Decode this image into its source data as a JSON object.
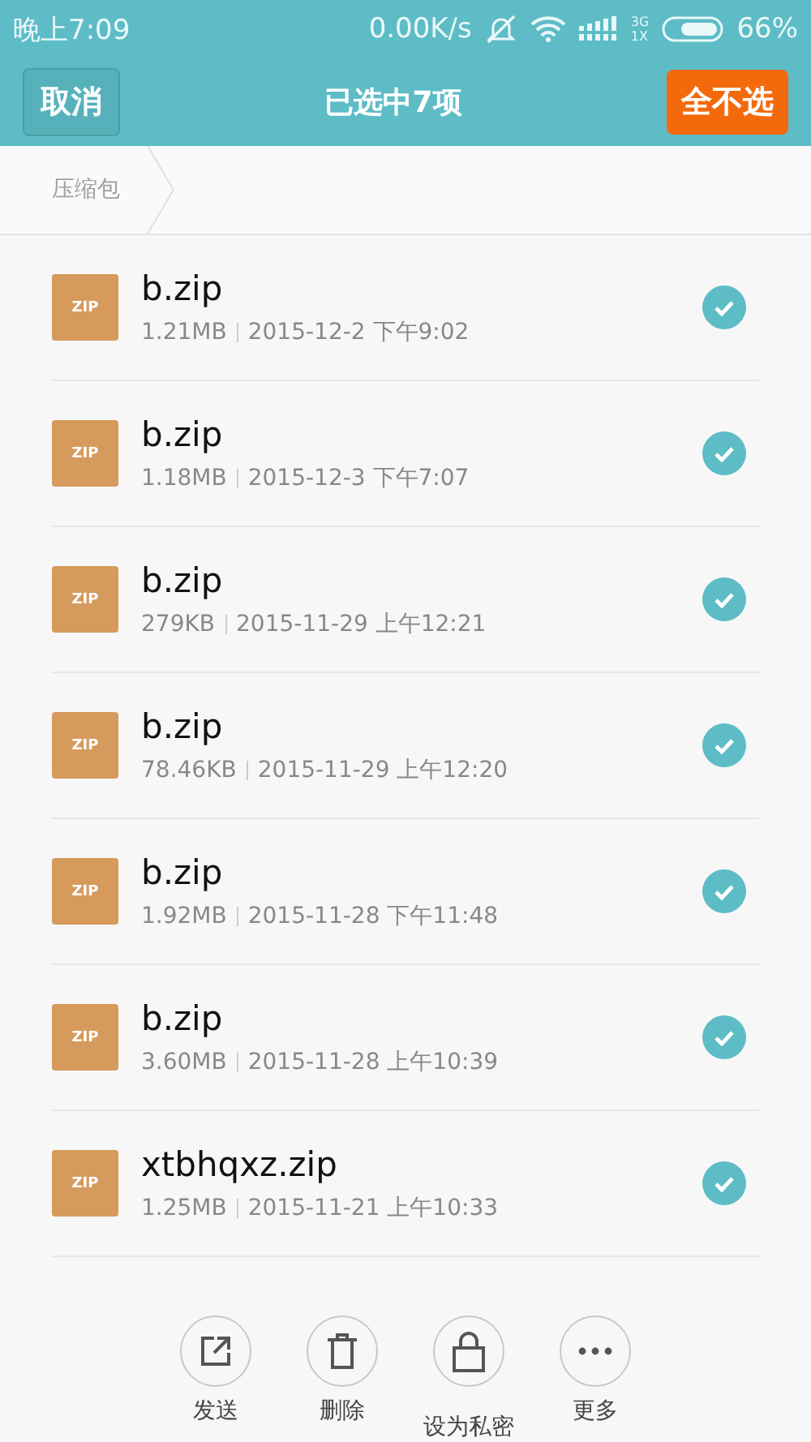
{
  "status_bar": {
    "time": "晚上7:09",
    "speed": "0.00K/s",
    "network_top": "3G",
    "network_bottom": "1X",
    "battery": "66%"
  },
  "header": {
    "cancel": "取消",
    "title": "已选中7项",
    "deselect_all": "全不选"
  },
  "breadcrumb": {
    "items": [
      "压缩包"
    ]
  },
  "files": [
    {
      "name": "b.zip",
      "type": "ZIP",
      "size": "1.21MB",
      "date": "2015-12-2 下午9:02",
      "selected": true
    },
    {
      "name": "b.zip",
      "type": "ZIP",
      "size": "1.18MB",
      "date": "2015-12-3 下午7:07",
      "selected": true
    },
    {
      "name": "b.zip",
      "type": "ZIP",
      "size": "279KB",
      "date": "2015-11-29 上午12:21",
      "selected": true
    },
    {
      "name": "b.zip",
      "type": "ZIP",
      "size": "78.46KB",
      "date": "2015-11-29 上午12:20",
      "selected": true
    },
    {
      "name": "b.zip",
      "type": "ZIP",
      "size": "1.92MB",
      "date": "2015-11-28 下午11:48",
      "selected": true
    },
    {
      "name": "b.zip",
      "type": "ZIP",
      "size": "3.60MB",
      "date": "2015-11-28 上午10:39",
      "selected": true
    },
    {
      "name": "xtbhqxz.zip",
      "type": "ZIP",
      "size": "1.25MB",
      "date": "2015-11-21 上午10:33",
      "selected": true
    }
  ],
  "actions": [
    {
      "kind": "send",
      "label": "发送"
    },
    {
      "kind": "delete",
      "label": "删除"
    },
    {
      "kind": "private",
      "label": "设为私密"
    },
    {
      "kind": "more",
      "label": "更多"
    }
  ]
}
